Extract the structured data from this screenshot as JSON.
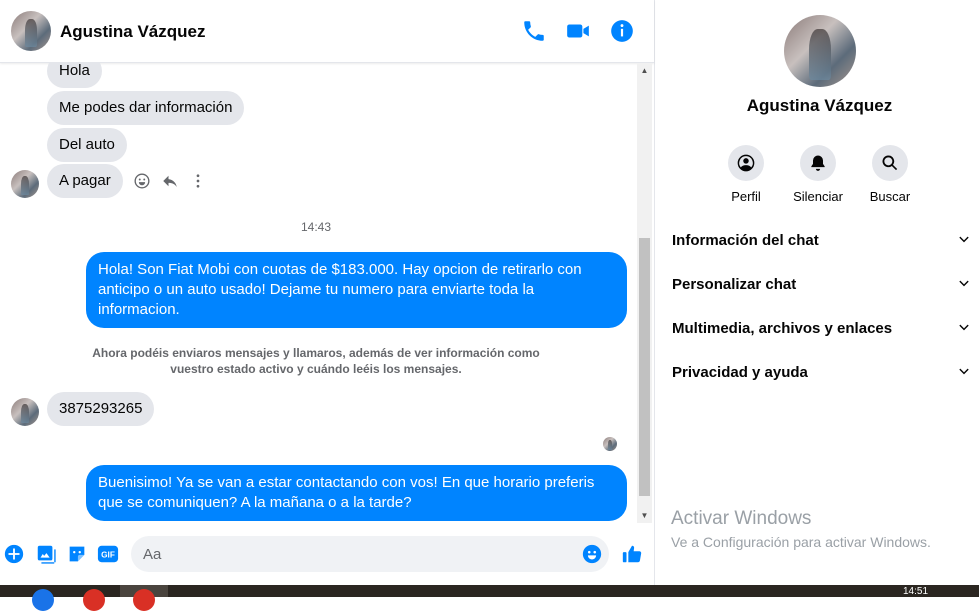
{
  "header": {
    "name": "Agustina Vázquez",
    "icons": [
      "phone-icon",
      "video-icon",
      "info-icon"
    ]
  },
  "messages": {
    "incoming_group1": [
      "Hola",
      "Me podes dar información",
      "Del auto",
      "A pagar"
    ],
    "timestamp": "14:43",
    "outgoing1": "Hola! Son Fiat Mobi con cuotas de $183.000. Hay opcion de retirarlo con anticipo o un auto usado! Dejame tu numero para enviarte toda la informacion.",
    "notice": "Ahora podéis enviaros mensajes y llamaros, además de ver información como vuestro estado activo y cuándo leéis los mensajes.",
    "incoming2": "3875293265",
    "outgoing2": "Buenisimo! Ya se van a estar contactando con vos! En que horario preferis que se comuniquen? A la mañana o a la tarde?"
  },
  "composer": {
    "placeholder": "Aa",
    "icons": [
      "plus-icon",
      "image-icon",
      "sticker-icon",
      "gif-icon",
      "emoji-icon",
      "like-icon"
    ]
  },
  "info_panel": {
    "name": "Agustina Vázquez",
    "actions": [
      {
        "label": "Perfil",
        "icon": "profile-icon"
      },
      {
        "label": "Silenciar",
        "icon": "bell-icon"
      },
      {
        "label": "Buscar",
        "icon": "search-icon"
      }
    ],
    "sections": [
      "Información del chat",
      "Personalizar chat",
      "Multimedia, archivos y enlaces",
      "Privacidad y ayuda"
    ]
  },
  "watermark": {
    "title": "Activar Windows",
    "subtitle": "Ve a Configuración para activar Windows."
  },
  "taskbar": {
    "clock": "14:51"
  },
  "colors": {
    "accent": "#0084ff",
    "bubble_in": "#e4e6eb",
    "text_secondary": "#65676b"
  }
}
